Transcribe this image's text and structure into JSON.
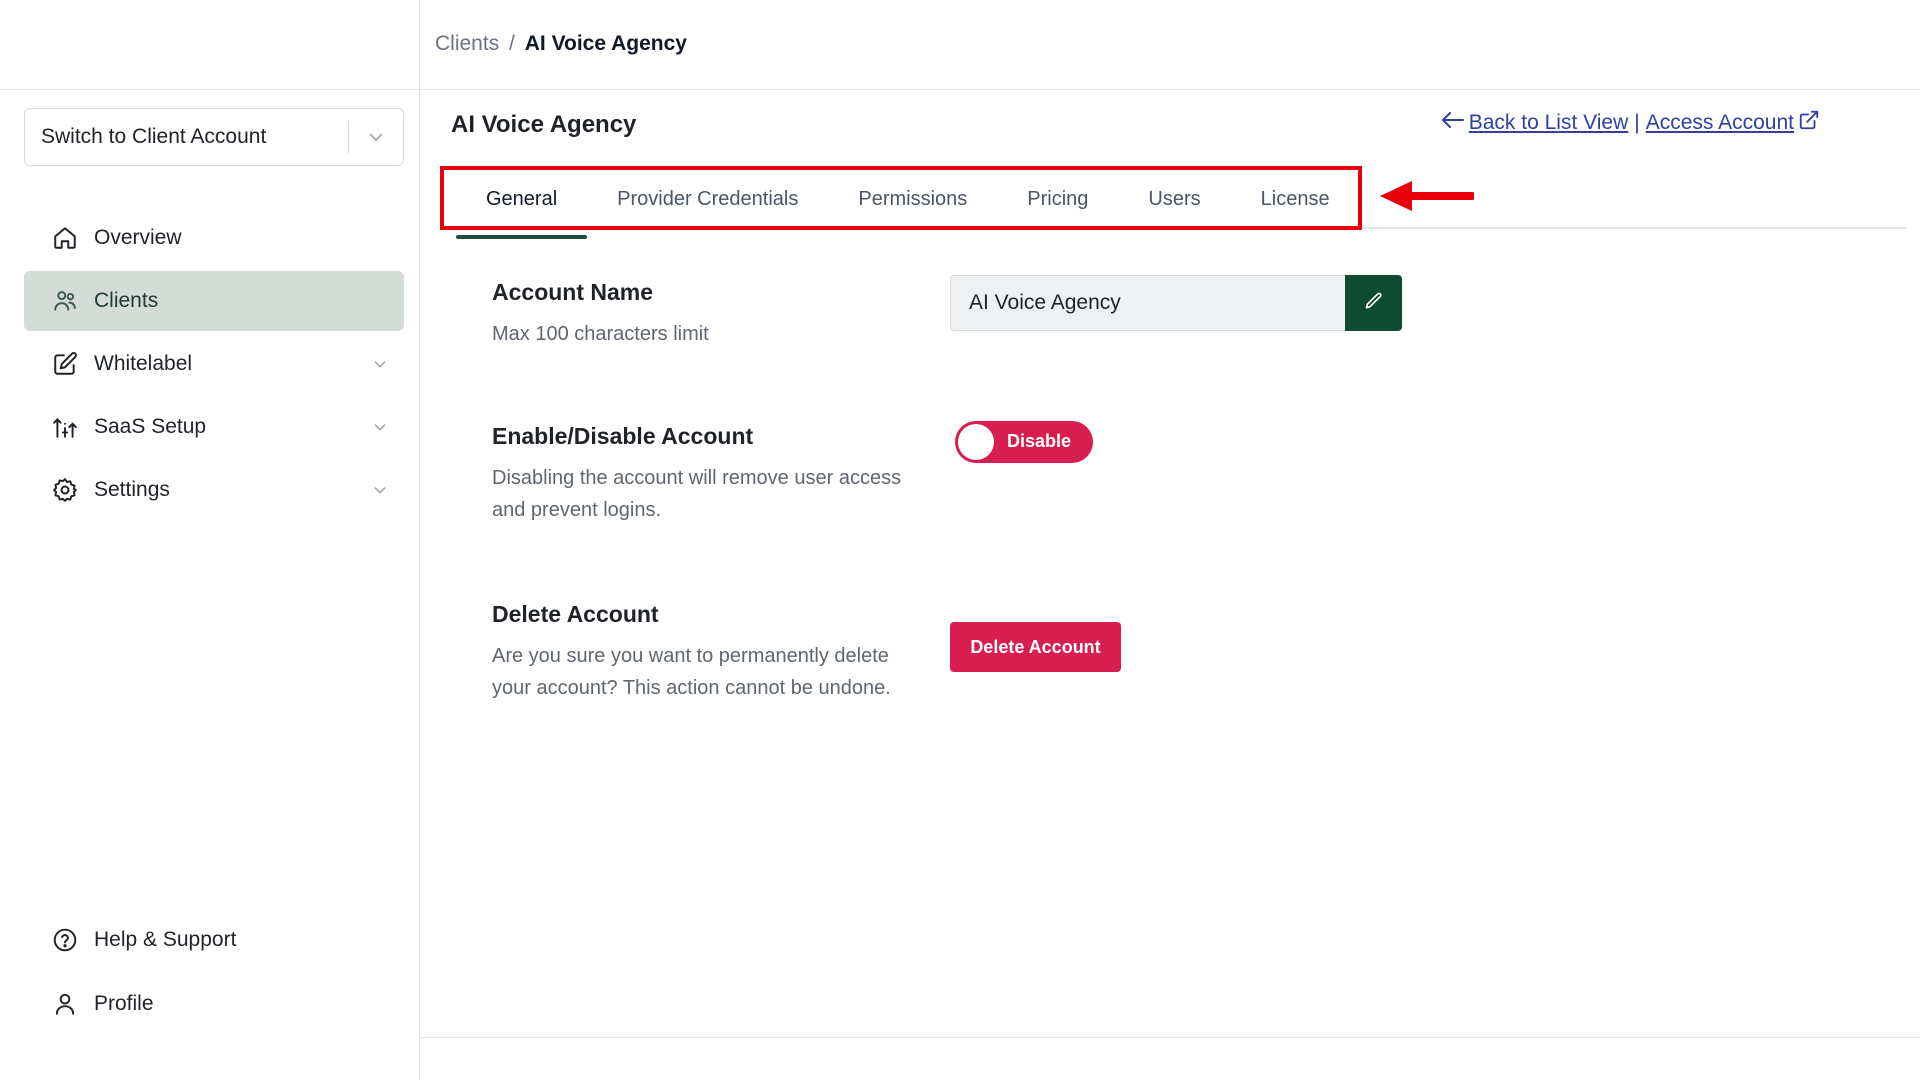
{
  "breadcrumb": {
    "parent": "Clients",
    "separator": "/",
    "current": "AI Voice Agency"
  },
  "sidebar": {
    "switch_account": {
      "label": "Switch to Client Account"
    },
    "items": [
      {
        "label": "Overview",
        "icon": "home-icon"
      },
      {
        "label": "Clients",
        "icon": "users-icon",
        "active": true
      },
      {
        "label": "Whitelabel",
        "icon": "edit-square-icon",
        "expandable": true
      },
      {
        "label": "SaaS Setup",
        "icon": "saas-icon",
        "expandable": true
      },
      {
        "label": "Settings",
        "icon": "gear-icon",
        "expandable": true
      }
    ],
    "bottom_items": [
      {
        "label": "Help & Support",
        "icon": "help-circle-icon"
      },
      {
        "label": "Profile",
        "icon": "user-icon"
      }
    ]
  },
  "main": {
    "title": "AI Voice Agency",
    "links": {
      "back": "Back to List View",
      "separator": "|",
      "access": "Access Account"
    },
    "tabs": [
      {
        "label": "General",
        "active": true
      },
      {
        "label": "Provider Credentials"
      },
      {
        "label": "Permissions"
      },
      {
        "label": "Pricing"
      },
      {
        "label": "Users"
      },
      {
        "label": "License"
      }
    ],
    "account_name": {
      "title": "Account Name",
      "description": "Max 100 characters limit",
      "value": "AI Voice Agency"
    },
    "enable_disable": {
      "title": "Enable/Disable Account",
      "description": "Disabling the account will remove user access and prevent logins.",
      "toggle_label": "Disable"
    },
    "delete_account": {
      "title": "Delete Account",
      "description": "Are you sure you want to permanently delete your account? This action cannot be undone.",
      "button_label": "Delete Account"
    }
  },
  "colors": {
    "accent_dark_green": "#0f4a33",
    "active_nav_bg": "#d3dcd7",
    "danger": "#d81e4f",
    "link": "#2f3fa6",
    "annotation_red": "#e8000d"
  }
}
